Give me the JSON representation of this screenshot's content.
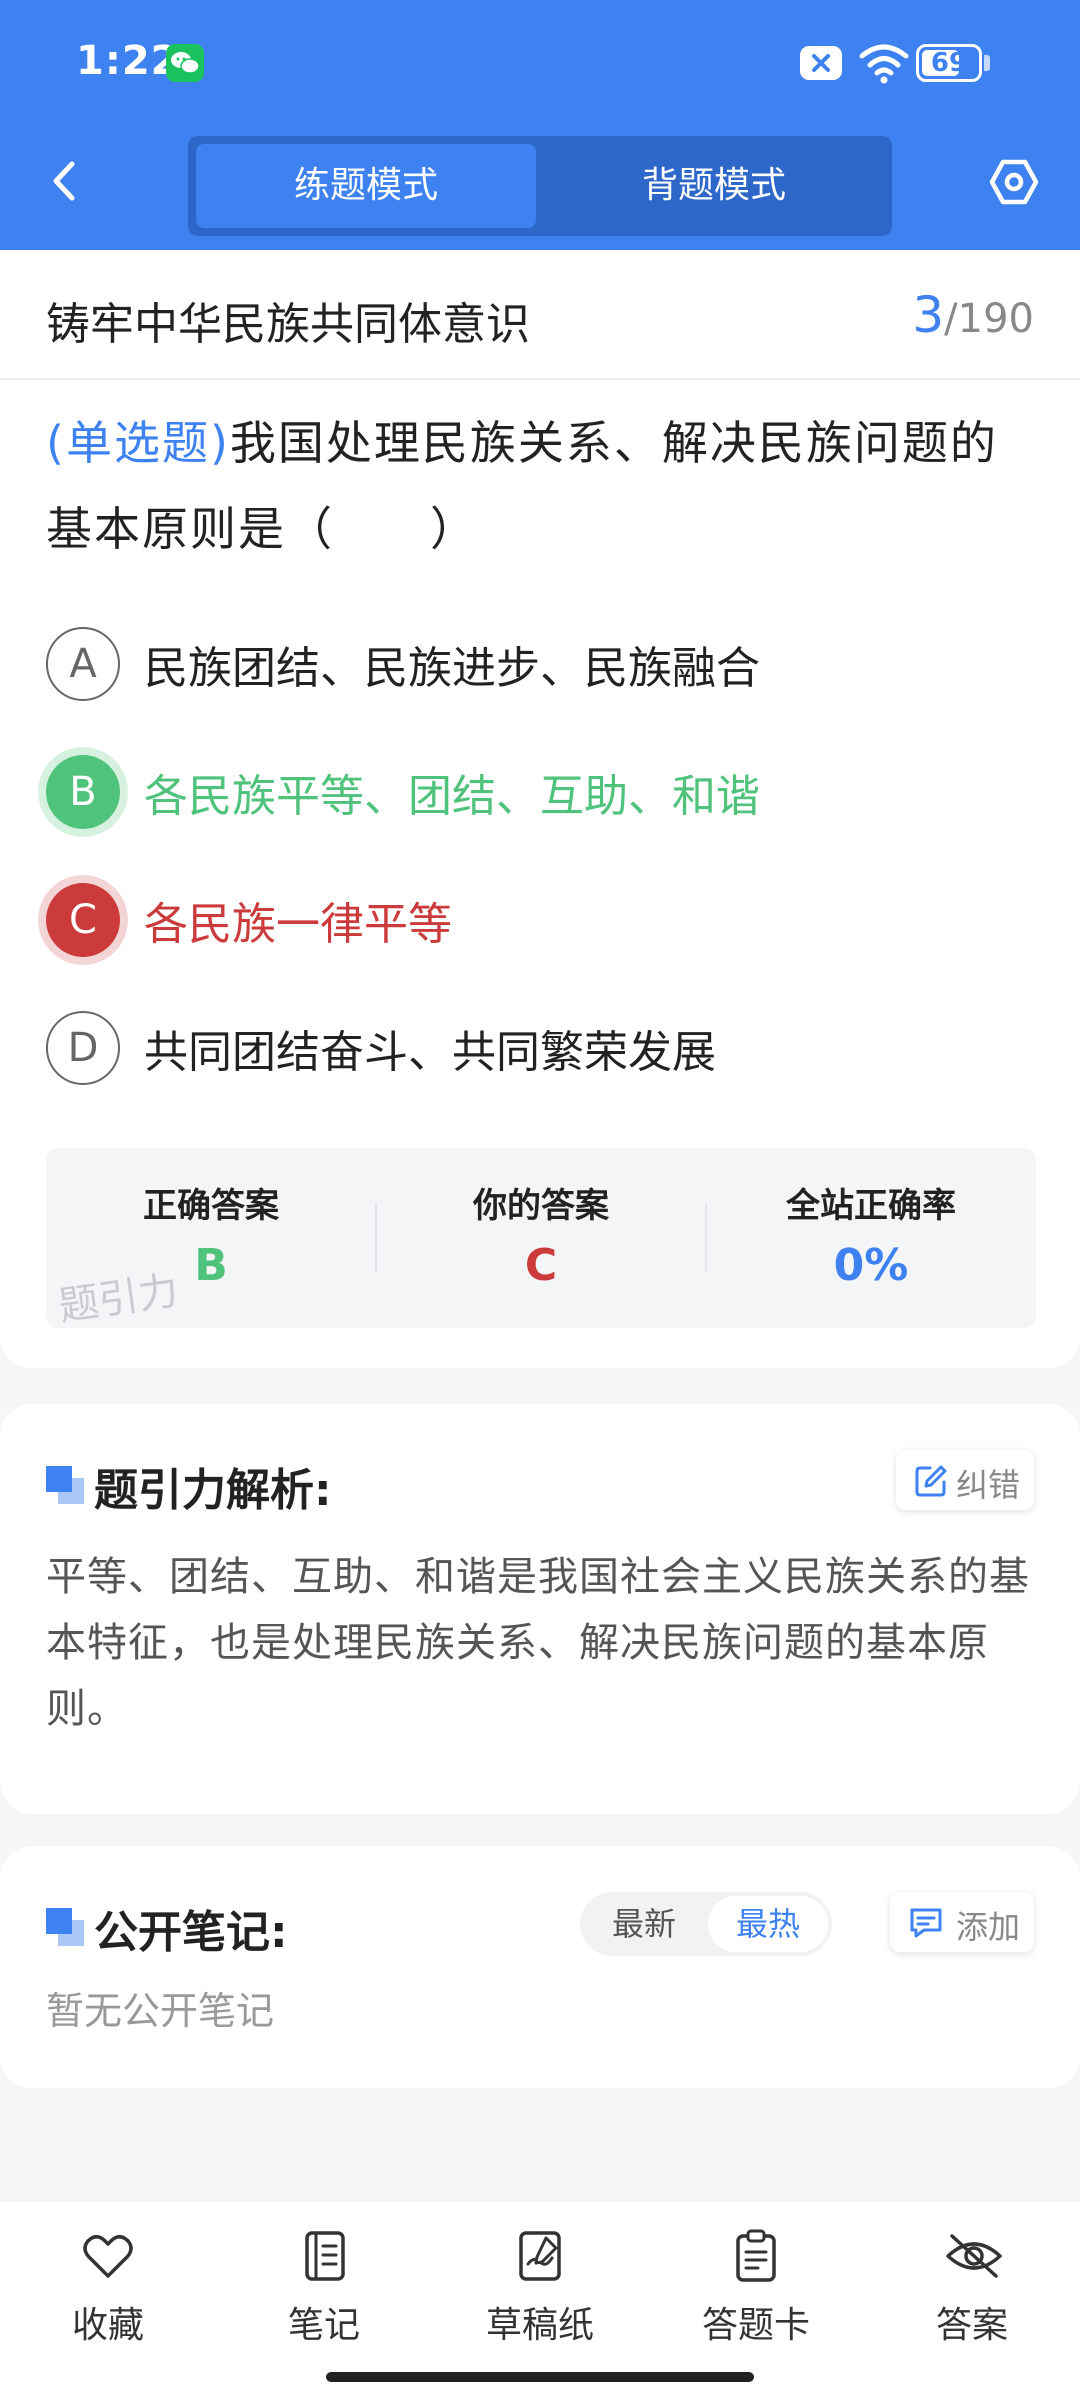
{
  "status_bar": {
    "time": "1:22",
    "battery": "69",
    "battery_level": 0.69
  },
  "nav": {
    "modes": [
      "练题模式",
      "背题模式"
    ],
    "active_mode": "练题模式"
  },
  "chapter": {
    "title": "铸牢中华民族共同体意识",
    "current": "3",
    "total": "/190"
  },
  "question": {
    "type_label": "(单选题)",
    "text": "我国处理民族关系、解决民族问题的基本原则是（　　）",
    "options": [
      {
        "letter": "A",
        "text": "民族团结、民族进步、民族融合",
        "state": "normal"
      },
      {
        "letter": "B",
        "text": "各民族平等、团结、互助、和谐",
        "state": "correct"
      },
      {
        "letter": "C",
        "text": "各民族一律平等",
        "state": "wrong"
      },
      {
        "letter": "D",
        "text": "共同团结奋斗、共同繁荣发展",
        "state": "normal"
      }
    ]
  },
  "answer_summary": {
    "correct_label": "正确答案",
    "correct_value": "B",
    "yours_label": "你的答案",
    "yours_value": "C",
    "rate_label": "全站正确率",
    "rate_value": "0%",
    "watermark": "题引力",
    "colors": {
      "correct": "#4fc27c",
      "wrong": "#cc3b3b",
      "rate": "#3d82f0"
    }
  },
  "analysis": {
    "title": "题引力解析:",
    "feedback_label": "纠错",
    "text": "平等、团结、互助、和谐是我国社会主义民族关系的基本特征，也是处理民族关系、解决民族问题的基本原则。"
  },
  "notes": {
    "title": "公开笔记:",
    "sort_newest": "最新",
    "sort_hottest": "最热",
    "add_label": "添加",
    "empty_text": "暂无公开笔记"
  },
  "bottom_tabs": [
    {
      "label": "收藏",
      "icon": "heart-icon"
    },
    {
      "label": "笔记",
      "icon": "notebook-icon"
    },
    {
      "label": "草稿纸",
      "icon": "draft-icon"
    },
    {
      "label": "答题卡",
      "icon": "answer-sheet-icon"
    },
    {
      "label": "答案",
      "icon": "eye-off-icon"
    }
  ],
  "colors": {
    "primary": "#3d82f0",
    "correct": "#4fc27c",
    "wrong": "#cc3b3b"
  }
}
